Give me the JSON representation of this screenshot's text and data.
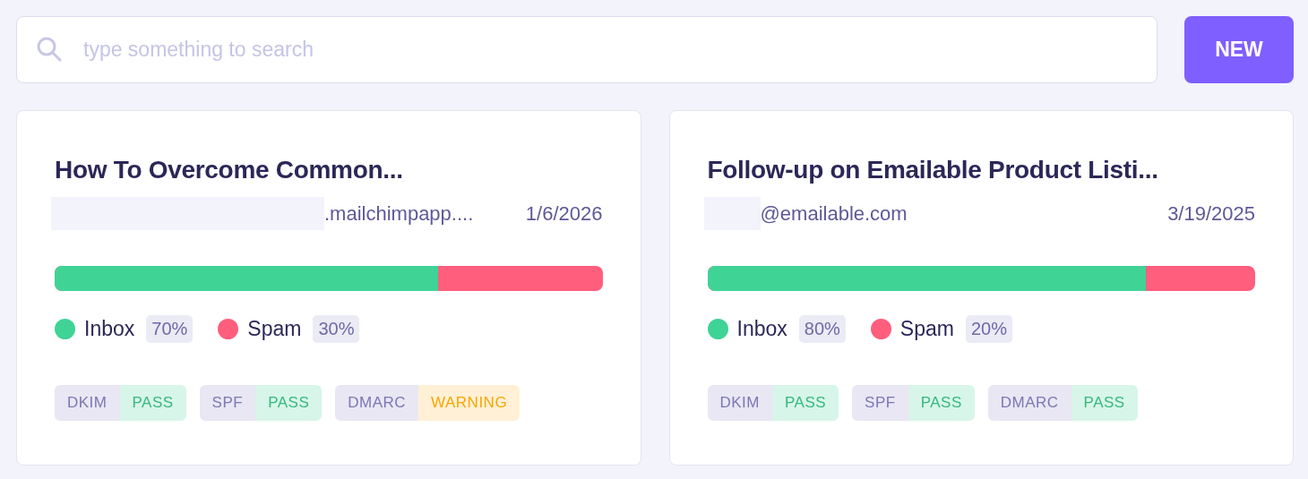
{
  "search": {
    "placeholder": "type something to search"
  },
  "new_button": {
    "label": "NEW"
  },
  "cards": [
    {
      "title": "How To Overcome Common...",
      "kind": "long",
      "sender": ".mailchimpapp....",
      "date": "1/6/2026",
      "level": 0.7,
      "legend": [
        {
          "label": "Inbox",
          "value": "70%",
          "color": "#40d396"
        },
        {
          "label": "Spam",
          "value": "30%",
          "color": "#ff5e7d"
        }
      ],
      "checks": [
        {
          "name": "DKIM",
          "result": "PASS",
          "kind": "pass"
        },
        {
          "name": "SPF",
          "result": "PASS",
          "kind": "pass"
        },
        {
          "name": "DMARC",
          "result": "WARNING",
          "kind": "warning"
        }
      ]
    },
    {
      "title": "Follow-up on Emailable Product Listi...",
      "kind": "short",
      "sender": "@emailable.com",
      "date": "3/19/2025",
      "level": 0.8,
      "legend": [
        {
          "label": "Inbox",
          "value": "80%",
          "color": "#40d396"
        },
        {
          "label": "Spam",
          "value": "20%",
          "color": "#ff5e7d"
        }
      ],
      "checks": [
        {
          "name": "DKIM",
          "result": "PASS",
          "kind": "pass"
        },
        {
          "name": "SPF",
          "result": "PASS",
          "kind": "pass"
        },
        {
          "name": "DMARC",
          "result": "PASS",
          "kind": "pass"
        }
      ]
    }
  ]
}
